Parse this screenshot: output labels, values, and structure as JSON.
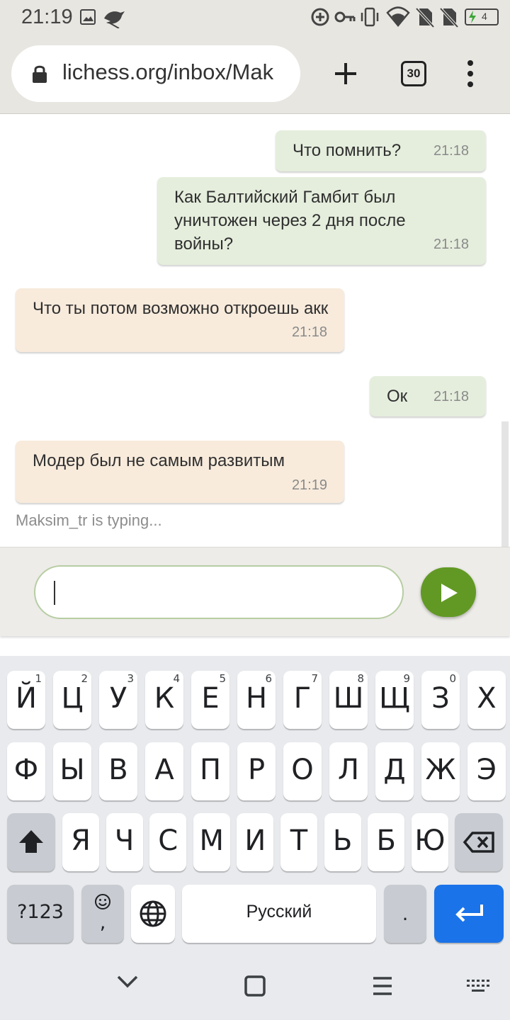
{
  "status_bar": {
    "time": "21:19",
    "battery_level": "4",
    "icons": [
      "gallery-icon",
      "bird-icon",
      "data-saver-icon",
      "vpn-key-icon",
      "vibrate-icon",
      "wifi-icon",
      "no-sim-icon",
      "no-sim-icon",
      "battery-charging-icon"
    ]
  },
  "browser": {
    "url": "lichess.org/inbox/Mak",
    "tab_count": "30",
    "icons": [
      "lock-icon",
      "new-tab-plus-icon",
      "tabs-icon",
      "more-menu-icon"
    ]
  },
  "chat": {
    "messages": [
      {
        "direction": "out",
        "text": "Что помнить?",
        "time": "21:18"
      },
      {
        "direction": "out",
        "text": "Как Балтийский Гамбит был уничтожен через 2 дня после войны?",
        "time": "21:18"
      },
      {
        "direction": "in",
        "text": "Что ты потом возможно откроешь акк",
        "time": "21:18"
      },
      {
        "direction": "out",
        "text": "Ок",
        "time": "21:18"
      },
      {
        "direction": "in",
        "text": "Модер был не самым развитым",
        "time": "21:19"
      }
    ],
    "typing_indicator": "Maksim_tr is typing..."
  },
  "composer": {
    "input_value": "",
    "send_icon": "send-play-icon"
  },
  "keyboard": {
    "row1": [
      {
        "label": "Й",
        "hint": "1"
      },
      {
        "label": "Ц",
        "hint": "2"
      },
      {
        "label": "У",
        "hint": "3"
      },
      {
        "label": "К",
        "hint": "4"
      },
      {
        "label": "Е",
        "hint": "5"
      },
      {
        "label": "Н",
        "hint": "6"
      },
      {
        "label": "Г",
        "hint": "7"
      },
      {
        "label": "Ш",
        "hint": "8"
      },
      {
        "label": "Щ",
        "hint": "9"
      },
      {
        "label": "З",
        "hint": "0"
      },
      {
        "label": "Х",
        "hint": ""
      }
    ],
    "row2": [
      "Ф",
      "Ы",
      "В",
      "А",
      "П",
      "Р",
      "О",
      "Л",
      "Д",
      "Ж",
      "Э"
    ],
    "row3": [
      "Я",
      "Ч",
      "С",
      "М",
      "И",
      "Т",
      "Ь",
      "Б",
      "Ю"
    ],
    "symbols_label": "?123",
    "comma_label": ",",
    "space_label": "Русский",
    "period_label": ".",
    "accent_color": "#1a73e8"
  },
  "nav_bar": {
    "icons": [
      "hide-keyboard-icon",
      "home-icon",
      "recents-icon",
      "keyboard-switch-icon"
    ]
  },
  "colors": {
    "outgoing_bubble": "#e5eedd",
    "incoming_bubble": "#f8ebdc",
    "send_button": "#629924",
    "chrome": "#e8e6e1"
  }
}
